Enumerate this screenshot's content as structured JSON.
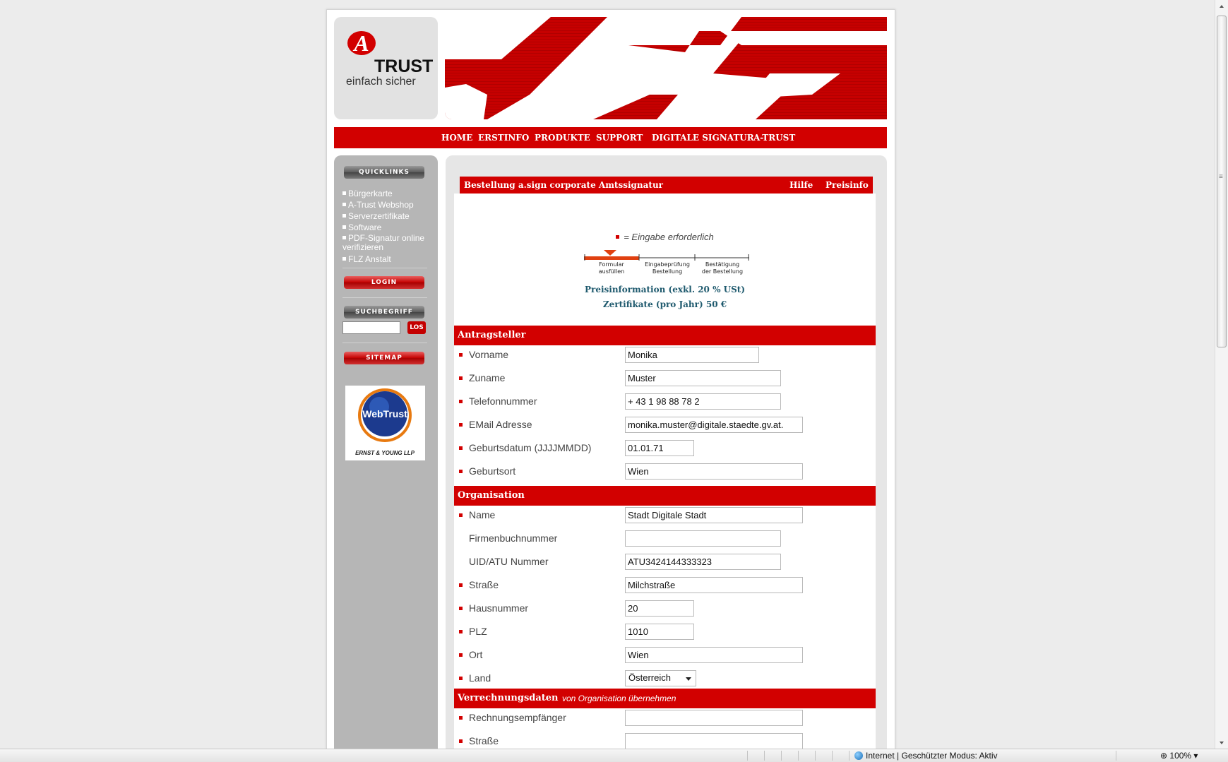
{
  "logo": {
    "brand": "TRUST",
    "tagline": "einfach sicher"
  },
  "topnav": [
    "HOME",
    "ERSTINFO",
    "PRODUKTE",
    "SUPPORT",
    "DIGITALE SIGNATUR",
    "A-TRUST"
  ],
  "sidebar": {
    "quicklinks_title": "QUICKLINKS",
    "links": [
      "Bürgerkarte",
      "A-Trust Webshop",
      "Serverzertifikate",
      "Software",
      "PDF-Signatur online verifizieren",
      "FLZ Anstalt"
    ],
    "login_label": "LOGIN",
    "search_title": "SUCHBEGRIFF",
    "search_value": "",
    "search_button": "LOS",
    "sitemap_label": "SITEMAP",
    "badge_name": "WebTrust",
    "badge_sub": "ERNST & YOUNG LLP"
  },
  "form": {
    "title": "Bestellung a.sign corporate Amtssignatur",
    "help_link": "Hilfe",
    "price_link": "Preisinfo",
    "required_note": "= Eingabe erforderlich",
    "steps": [
      {
        "line1": "Formular",
        "line2": "ausfüllen"
      },
      {
        "line1": "Eingabeprüfung",
        "line2": "Bestellung"
      },
      {
        "line1": "Bestätigung",
        "line2": "der Bestellung"
      }
    ],
    "price_heading": "Preisinformation (exkl. 20 % USt)",
    "price_value": "Zertifikate (pro Jahr) 50 €",
    "sections": {
      "applicant": "Antragsteller",
      "organisation": "Organisation",
      "billing": "Verrechnungsdaten",
      "billing_note": "von Organisation übernehmen"
    },
    "applicant": {
      "vorname": {
        "label": "Vorname",
        "value": "Monika"
      },
      "zuname": {
        "label": "Zuname",
        "value": "Muster"
      },
      "telefon": {
        "label": "Telefonnummer",
        "value": "+ 43 1 98 88 78 2"
      },
      "email": {
        "label": "EMail Adresse",
        "value": "monika.muster@digitale.staedte.gv.at."
      },
      "geburtsdatum": {
        "label": "Geburtsdatum (JJJJMMDD)",
        "value": "01.01.71"
      },
      "geburtsort": {
        "label": "Geburtsort",
        "value": "Wien"
      }
    },
    "organisation": {
      "name": {
        "label": "Name",
        "value": "Stadt Digitale Stadt"
      },
      "firmenbuch": {
        "label": "Firmenbuchnummer",
        "value": ""
      },
      "uid": {
        "label": "UID/ATU Nummer",
        "value": "ATU3424144333323"
      },
      "strasse": {
        "label": "Straße",
        "value": "Milchstraße"
      },
      "hausnummer": {
        "label": "Hausnummer",
        "value": "20"
      },
      "plz": {
        "label": "PLZ",
        "value": "1010"
      },
      "ort": {
        "label": "Ort",
        "value": "Wien"
      },
      "land": {
        "label": "Land",
        "value": "Österreich"
      }
    },
    "billing": {
      "empfaenger": {
        "label": "Rechnungsempfänger",
        "value": ""
      },
      "strasse": {
        "label": "Straße",
        "value": ""
      }
    }
  },
  "statusbar": {
    "zone": "Internet | Geschützter Modus: Aktiv",
    "zoom": "100%"
  },
  "colors": {
    "brand_red": "#d20000",
    "sidebar_grey": "#b6b6b6",
    "price_blue": "#1f5a6e"
  }
}
